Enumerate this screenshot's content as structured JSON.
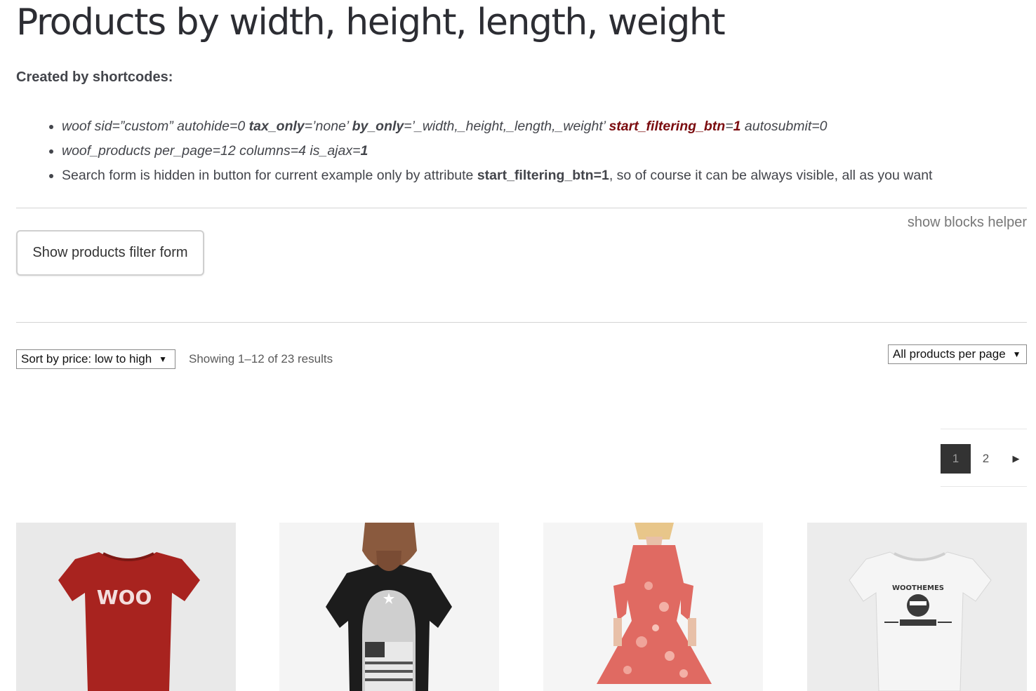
{
  "page": {
    "title": "Products by width, height, length, weight",
    "intro": "Created by shortcodes:"
  },
  "shortcodes": {
    "line1": {
      "p1": "woof sid=”custom” autohide=0 ",
      "p2": "tax_only",
      "p3": "=’none’ ",
      "p4": "by_only",
      "p5": "=’_width,_height,_length,_weight’ ",
      "p6": "start_filtering_btn",
      "p7": "=",
      "p8": "1",
      "p9": " autosubmit=0"
    },
    "line2": {
      "p1": "woof_products per_page=12 columns=4 is_ajax=",
      "p2": "1"
    },
    "line3": {
      "p1": "Search form is hidden in button for current example only by attribute ",
      "p2": "start_filtering_btn=1",
      "p3": ", so of course it can be always visible, all as you want"
    }
  },
  "helper_link": "show blocks helper",
  "filter_button": "Show products filter form",
  "toolbar": {
    "sort_value": "Sort by price: low to high",
    "result_count": "Showing 1–12 of 23 results",
    "per_page_value": "All products per page",
    "dropdown_arrow": "▼"
  },
  "pagination": {
    "current": "1",
    "page2": "2",
    "next": "▶"
  },
  "products": [
    {
      "image": "red-woo-tshirt",
      "print_text": "WOO",
      "color": "#a8231f"
    },
    {
      "image": "man-black-flag-tshirt",
      "color": "#1c1c1c"
    },
    {
      "image": "pink-floral-dress",
      "color": "#e06a62"
    },
    {
      "image": "white-woothemes-tshirt",
      "print_text": "WOOTHEMES",
      "color": "#f2f2f2"
    }
  ]
}
